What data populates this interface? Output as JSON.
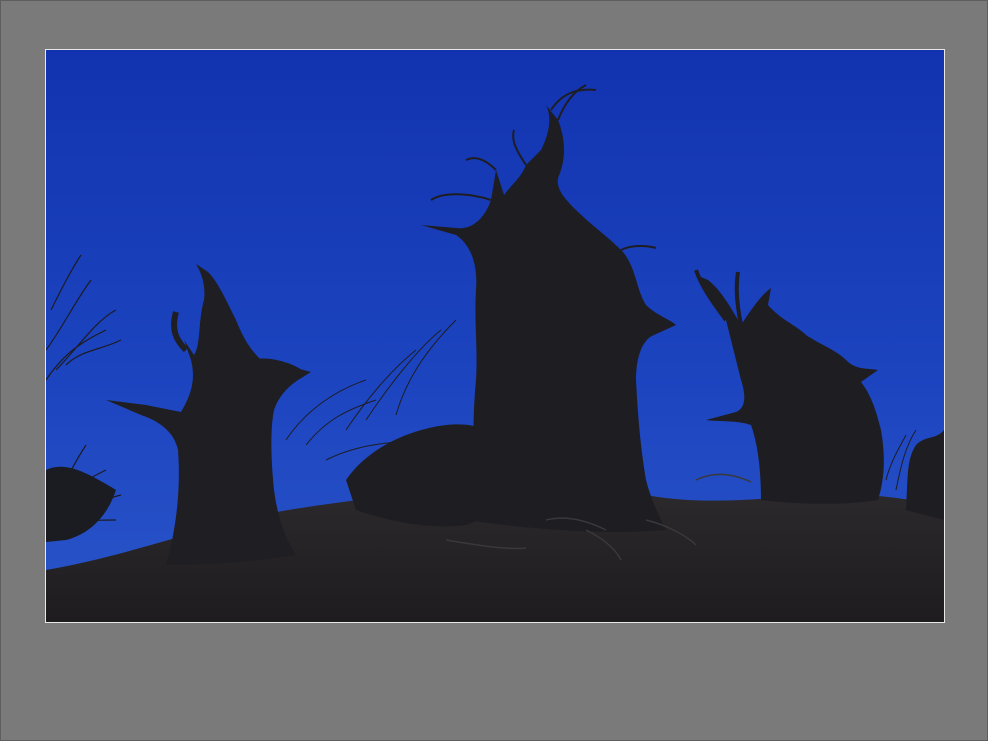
{
  "viewer": {
    "background_color": "#7a7a7a",
    "mat_border_color": "#e8e8e8"
  },
  "photo": {
    "subject": "silhouetted-dead-poplar-trees-at-dusk",
    "sky_color_top": "#1436b4",
    "sky_color_bottom": "#2a55c9",
    "ground_color": "#2a2a2e"
  }
}
